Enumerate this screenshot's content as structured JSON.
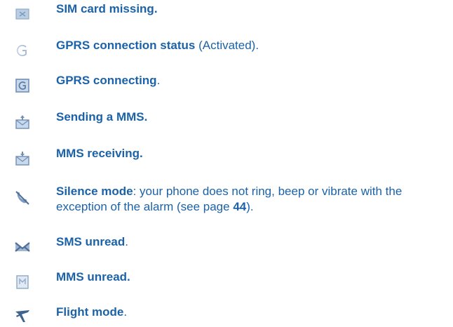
{
  "colors": {
    "text": "#1b62a8",
    "icon": "#8fa9c7",
    "icon_dark": "#5f7fa5"
  },
  "items": [
    {
      "icon": "sim-card-missing-icon",
      "title": "SIM card missing.",
      "desc": ""
    },
    {
      "icon": "gprs-status-icon",
      "title": "GPRS connection status",
      "desc": " (Activated)."
    },
    {
      "icon": "gprs-connecting-icon",
      "title": "GPRS connecting",
      "desc": "."
    },
    {
      "icon": "mms-sending-icon",
      "title": "Sending a MMS.",
      "desc": ""
    },
    {
      "icon": "mms-receiving-icon",
      "title": "MMS receiving.",
      "desc": ""
    },
    {
      "icon": "silence-mode-icon",
      "title": "Silence mode",
      "desc_pre": ": your phone does not ring, beep or vibrate with the exception of the alarm (see page ",
      "page": "44",
      "desc_post": ")."
    },
    {
      "icon": "sms-unread-icon",
      "title": "SMS unread",
      "desc": "."
    },
    {
      "icon": "mms-unread-icon",
      "title": "MMS unread.",
      "desc": ""
    },
    {
      "icon": "flight-mode-icon",
      "title": "Flight mode",
      "desc": "."
    }
  ]
}
